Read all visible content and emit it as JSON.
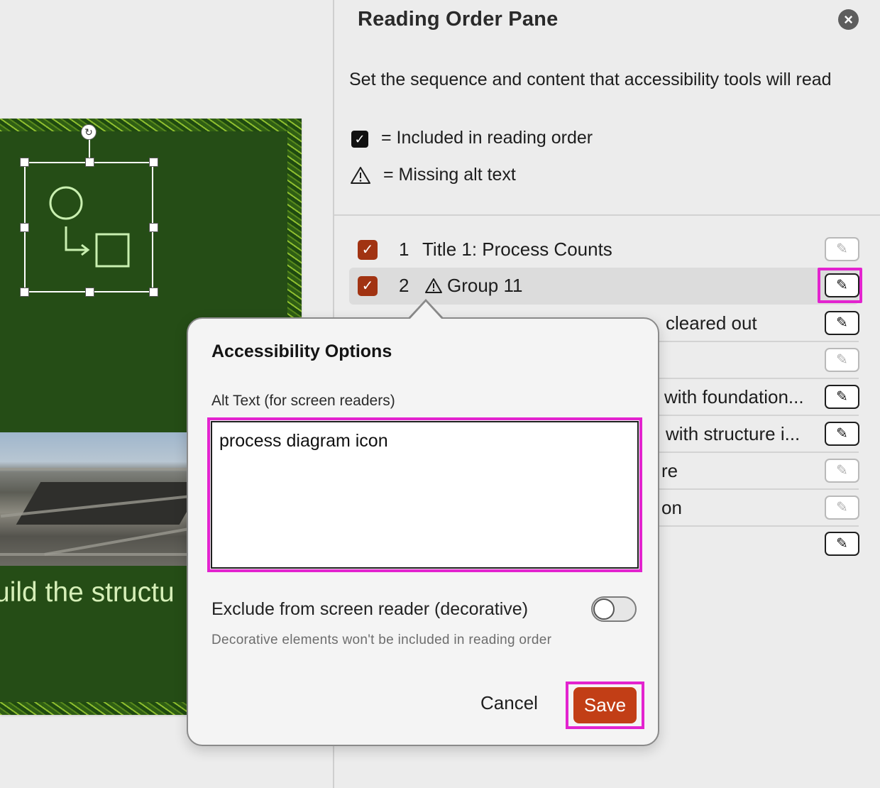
{
  "pane": {
    "title": "Reading Order Pane",
    "description": "Set the sequence and content that accessibility tools will read",
    "legend_included_text": "= Included in reading order",
    "legend_missing_text": "= Missing alt text",
    "items": [
      {
        "num": "1",
        "label": "Title 1: Process Counts",
        "checked": true
      },
      {
        "num": "2",
        "label": "Group 11",
        "checked": true,
        "missing_alt": true,
        "selected": true
      },
      {
        "num": "",
        "label": "cleared out"
      },
      {
        "num": "",
        "label": ""
      },
      {
        "num": "",
        "label": "with foundation..."
      },
      {
        "num": "",
        "label": "with structure i..."
      },
      {
        "num": "",
        "label": "re"
      },
      {
        "num": "",
        "label": "on"
      },
      {
        "num": "",
        "label": ""
      }
    ]
  },
  "slide": {
    "heading_fragment": "uild the structu"
  },
  "popover": {
    "title": "Accessibility Options",
    "alt_label": "Alt Text (for screen readers)",
    "alt_value": "process diagram icon",
    "exclude_label": "Exclude from screen reader (decorative)",
    "exclude_on": false,
    "exclude_help": "Decorative elements won't be included in reading order",
    "cancel": "Cancel",
    "save": "Save"
  },
  "colors": {
    "accent": "#c23e16",
    "checkbox": "#a13312",
    "highlight": "#e323cf",
    "slide_bg": "#254d16"
  }
}
